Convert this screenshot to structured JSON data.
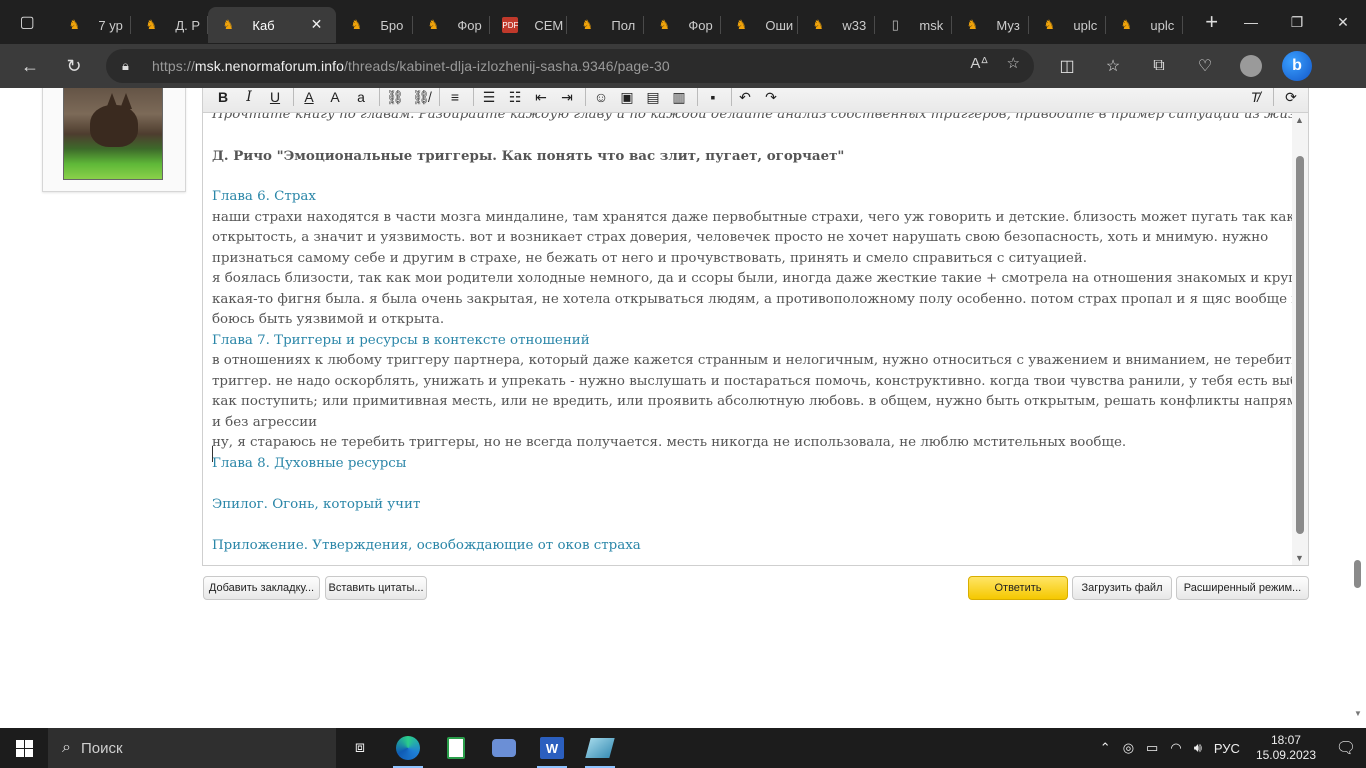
{
  "browser": {
    "tabs": [
      {
        "label": "7 ур",
        "favicon": "forum-icon"
      },
      {
        "label": "Д. Р",
        "favicon": "forum-icon"
      },
      {
        "label": "Каб",
        "favicon": "forum-icon",
        "active": true
      },
      {
        "label": "Бро",
        "favicon": "forum-icon"
      },
      {
        "label": "Фор",
        "favicon": "forum-icon"
      },
      {
        "label": "СЕМ",
        "favicon": "pdf-icon"
      },
      {
        "label": "Пол",
        "favicon": "forum-icon"
      },
      {
        "label": "Фор",
        "favicon": "forum-icon"
      },
      {
        "label": "Оши",
        "favicon": "forum-icon"
      },
      {
        "label": "w33",
        "favicon": "forum-icon"
      },
      {
        "label": "msk",
        "favicon": "document-icon"
      },
      {
        "label": "Муз",
        "favicon": "forum-icon"
      },
      {
        "label": "uplc",
        "favicon": "forum-icon"
      },
      {
        "label": "uplc",
        "favicon": "forum-icon"
      }
    ],
    "url_prefix": "https://",
    "url_host": "msk.nenormaforum.info",
    "url_path": "/threads/kabinet-dlja-izlozhenij-sasha.9346/page-30",
    "pdf_badge": "PDF"
  },
  "editor": {
    "toolbar": {
      "bold": "B",
      "italic": "I",
      "underline": "U",
      "font_color": "A",
      "font_size": "A",
      "font_family": "a"
    },
    "lines": [
      {
        "text": "Прочтите книгу по главам. Разбирайте каждую главу и по каждой делайте анализ собственных триггеров, приводите в пример ситуации из жизни.",
        "style": "italic"
      },
      {
        "text": "",
        "style": ""
      },
      {
        "text": "Д. Ричо \"Эмоциональные триггеры. Как понять что вас злит, пугает, огорчает\"",
        "style": "bold"
      },
      {
        "text": "",
        "style": ""
      },
      {
        "text": "Глава 6. Страх",
        "style": "blue"
      },
      {
        "text": "наши страхи находятся в части мозга миндалине, там хранятся даже первобытные страхи, чего уж говорить и детские. близость может пугать так как это",
        "style": ""
      },
      {
        "text": "открытость, а значит и уязвимость. вот и возникает страх доверия, человечек просто не хочет нарушать свою безопасность, хоть и мнимую. нужно",
        "style": ""
      },
      {
        "text": "признаться самому себе и другим в страхе, не бежать от него и прочувствовать, принять и смело справиться с ситуацией.",
        "style": ""
      },
      {
        "text": "   я боялась близости, так как мои родители холодные немного, да и ссоры были, иногда даже жесткие такие + смотрела на отношения знакомых и кругом",
        "style": ""
      },
      {
        "text": "какая-то фигня была. я была очень закрытая, не хотела открываться людям, а противоположному полу особенно. потом страх пропал и я щяс вообще не",
        "style": ""
      },
      {
        "text": "боюсь быть уязвимой и открыта.",
        "style": ""
      },
      {
        "text": "Глава 7. Триггеры и ресурсы в контексте отношений",
        "style": "blue"
      },
      {
        "text": "в отношениях к любому триггеру партнера, который даже кажется странным и нелогичным, нужно относиться с уважением и вниманием, не теребить этот",
        "style": ""
      },
      {
        "text": "триггер. не надо оскорблять, унижать и упрекать - нужно выслушать и постараться помочь, конструктивно. когда твои чувства ранили, у тебя есть выбор",
        "style": ""
      },
      {
        "text": "как поступить; или примитивная месть, или не вредить, или проявить абсолютную любовь. в общем, нужно быть открытым, решать конфликты напрямую",
        "style": ""
      },
      {
        "text": "и без агрессии",
        "style": ""
      },
      {
        "text": "   ну, я стараюсь не теребить триггеры, но не всегда получается. месть никогда не использовала, не люблю мстительных вообще.",
        "style": ""
      },
      {
        "text": "Глава 8. Духовные ресурсы",
        "style": "blue"
      },
      {
        "text": "",
        "style": ""
      },
      {
        "text": "Эпилог. Огонь, который учит",
        "style": "blue"
      },
      {
        "text": "",
        "style": ""
      },
      {
        "text": "Приложение. Утверждения, освобождающие от оков страха",
        "style": "blue"
      }
    ],
    "buttons": {
      "bookmark": "Добавить закладку...",
      "insert_quotes": "Вставить цитаты...",
      "reply": "Ответить",
      "upload": "Загрузить файл",
      "advanced": "Расширенный режим..."
    }
  },
  "taskbar": {
    "search_placeholder": "Поиск",
    "language": "РУС",
    "time": "18:07",
    "date": "15.09.2023"
  },
  "colors": {
    "heading_blue": "#2a86a8",
    "reply_button": "#f5c800",
    "tab_bar": "#202020",
    "toolbar": "#3b3b3b"
  }
}
